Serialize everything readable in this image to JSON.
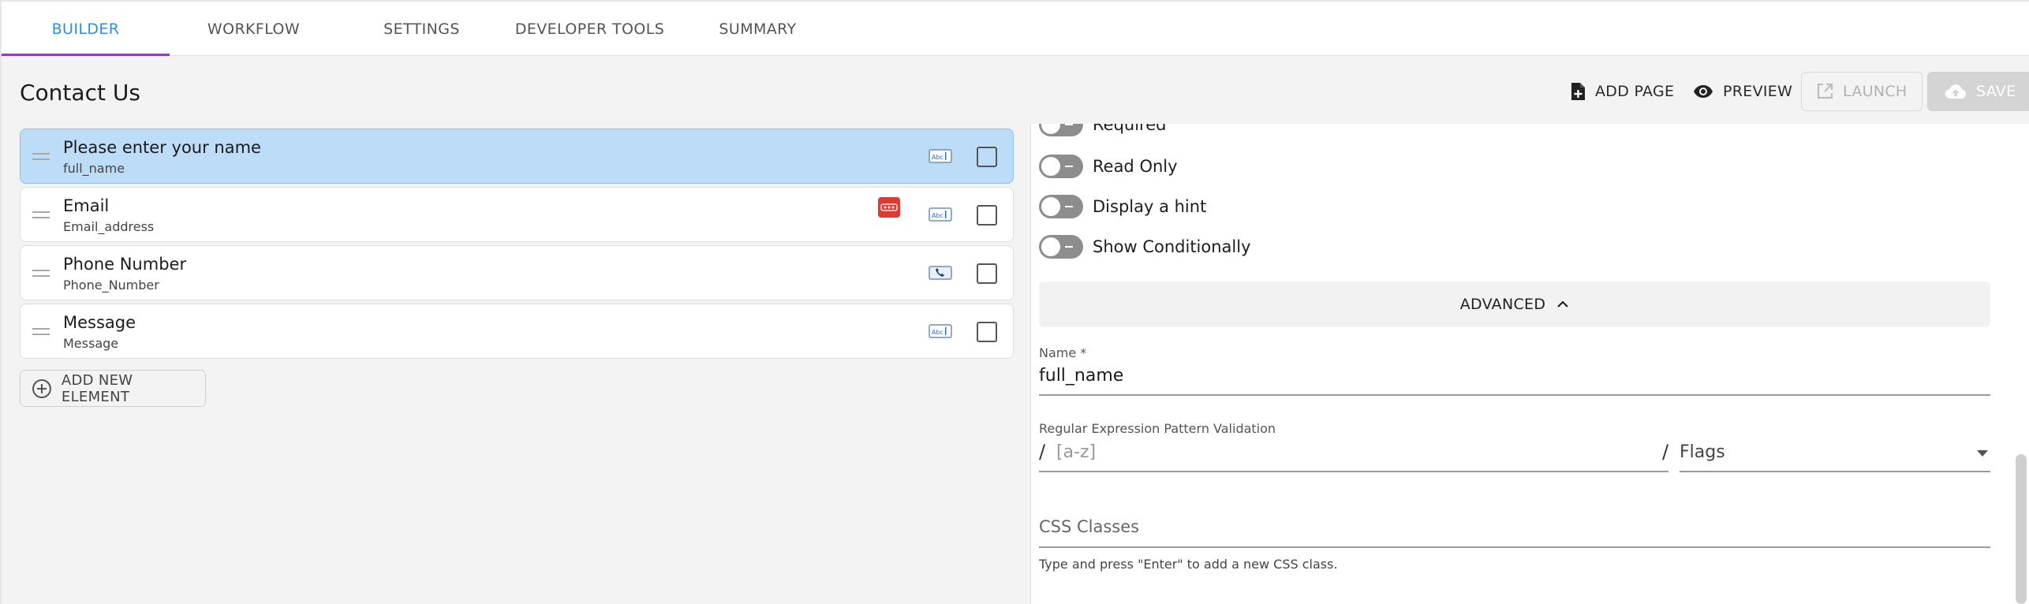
{
  "tabs": [
    {
      "label": "BUILDER",
      "active": true
    },
    {
      "label": "WORKFLOW",
      "active": false
    },
    {
      "label": "SETTINGS",
      "active": false
    },
    {
      "label": "DEVELOPER TOOLS",
      "active": false
    },
    {
      "label": "SUMMARY",
      "active": false
    }
  ],
  "page": {
    "title": "Contact Us"
  },
  "toolbar": {
    "add_page": "ADD PAGE",
    "preview": "PREVIEW",
    "launch": "LAUNCH",
    "save": "SAVE"
  },
  "elements": [
    {
      "label": "Please enter your name",
      "name": "full_name",
      "icon": "text-field-icon",
      "selected": true,
      "badge": false
    },
    {
      "label": "Email",
      "name": "Email_address",
      "icon": "text-field-icon",
      "selected": false,
      "badge": true
    },
    {
      "label": "Phone Number",
      "name": "Phone_Number",
      "icon": "phone-field-icon",
      "selected": false,
      "badge": false
    },
    {
      "label": "Message",
      "name": "Message",
      "icon": "text-field-icon",
      "selected": false,
      "badge": false
    }
  ],
  "add_element": "ADD NEW ELEMENT",
  "properties": {
    "toggles": [
      {
        "label": "Required"
      },
      {
        "label": "Read Only"
      },
      {
        "label": "Display a hint"
      },
      {
        "label": "Show Conditionally"
      }
    ],
    "advanced_label": "ADVANCED",
    "name_field": {
      "label": "Name *",
      "value": "full_name"
    },
    "regex_field": {
      "label": "Regular Expression Pattern Validation",
      "placeholder": "[a-z]",
      "slash": "/",
      "flags_label": "Flags"
    },
    "css_field": {
      "label": "CSS Classes",
      "helper": "Type and press \"Enter\" to add a new CSS class."
    }
  },
  "colors": {
    "accent": "#2f8fd8",
    "tab_indicator": "#8e3fc9",
    "selected_row": "#bcdcf7",
    "badge": "#dc3a34"
  }
}
